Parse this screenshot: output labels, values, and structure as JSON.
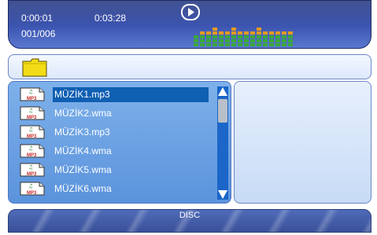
{
  "status": {
    "elapsed_time": "0:00:01",
    "total_time": "0:03:28",
    "track_counter": "001/006",
    "play_state": "play-icon"
  },
  "equalizer": {
    "bar_levels": [
      0.45,
      0.55,
      0.5,
      0.7,
      0.6,
      0.5,
      0.75,
      0.55,
      0.5,
      0.6,
      0.7,
      0.5,
      0.55,
      0.6,
      0.5,
      0.55
    ],
    "colors": {
      "low": "#3aa83c",
      "mid": "#e39b20",
      "high": "#d62a2a"
    }
  },
  "path": {
    "icon": "folder-icon"
  },
  "files": [
    {
      "name": "MÜZİK1.mp3",
      "icon_label": "MP3",
      "selected": true
    },
    {
      "name": "MÜZİK2.wma",
      "icon_label": "MP3",
      "selected": false
    },
    {
      "name": "MÜZİK3.mp3",
      "icon_label": "MP3",
      "selected": false
    },
    {
      "name": "MÜZİK4.wma",
      "icon_label": "MP3",
      "selected": false
    },
    {
      "name": "MÜZİK5.wma",
      "icon_label": "MP3",
      "selected": false
    },
    {
      "name": "MÜZİK6.wma",
      "icon_label": "MP3",
      "selected": false
    }
  ],
  "scroll": {
    "position": 0.0
  },
  "source": {
    "label": "DISC"
  },
  "colors": {
    "status_bg": "#3d56b2",
    "list_bg": "#6aa1e3",
    "selection": "#0f5fb2",
    "info_bg": "#d8e6fa"
  }
}
